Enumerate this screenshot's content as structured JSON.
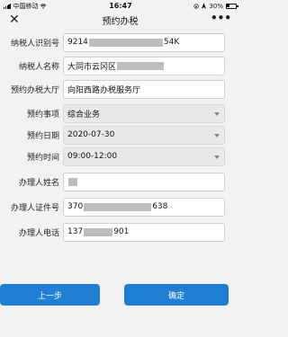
{
  "status": {
    "carrier": "中国移动",
    "time": "16:47",
    "battery": "30%"
  },
  "nav": {
    "close_icon": "close-icon",
    "title": "预约办税",
    "more": "•••"
  },
  "form": {
    "taxpayer_id": {
      "label": "纳税人识别号",
      "value_prefix": "9214",
      "value_suffix": "54K"
    },
    "taxpayer_name": {
      "label": "纳税人名称",
      "value": "大同市云冈区"
    },
    "hall": {
      "label": "预约办税大厅",
      "value": "向阳西路办税服务厅"
    },
    "item": {
      "label": "预约事项",
      "value": "综合业务"
    },
    "date": {
      "label": "预约日期",
      "value": "2020-07-30"
    },
    "time": {
      "label": "预约时间",
      "value": "09:00-12:00"
    },
    "agent_name": {
      "label": "办理人姓名",
      "value": ""
    },
    "agent_id": {
      "label": "办理人证件号",
      "value_prefix": "370",
      "value_suffix": "638"
    },
    "agent_phone": {
      "label": "办理人电话",
      "value_prefix": "137",
      "value_suffix": "901"
    }
  },
  "buttons": {
    "prev": "上一步",
    "confirm": "确定"
  },
  "colors": {
    "primary": "#1f7fd3",
    "background": "#f2f2f2",
    "redaction": "#bdbdbd"
  }
}
